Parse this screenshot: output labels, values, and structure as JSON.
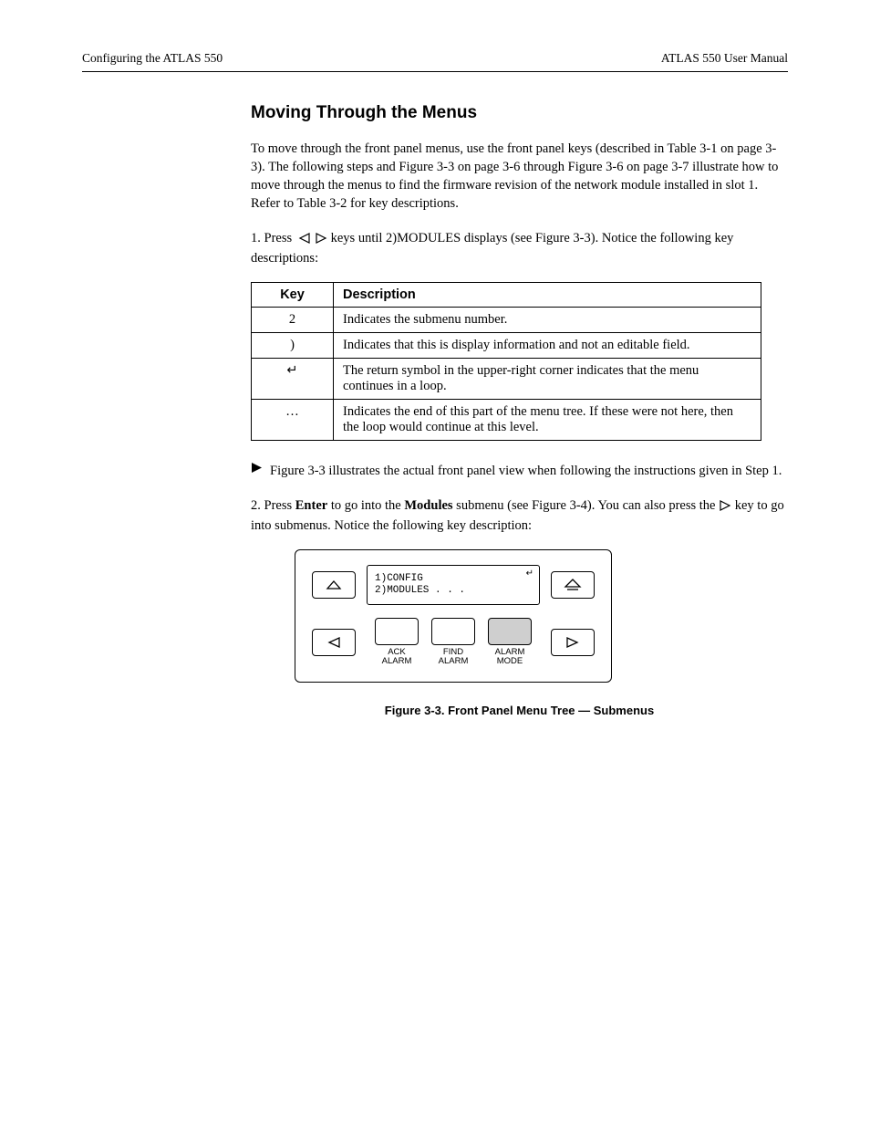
{
  "header": {
    "left": "Configuring the ATLAS 550",
    "right": "ATLAS 550 User Manual"
  },
  "title": "Moving Through the Menus",
  "intro1": "To move through the front panel menus, use the front panel keys (described in Table 3-1 on page 3-3). The following steps and Figure 3-3 on page 3-6 through Figure 3-6 on page 3-7 illustrate how to move through the menus to find the firmware revision of the network module installed in slot 1. Refer to Table 3-2 for key descriptions.",
  "step1_lead": "1.    Press",
  "step1_rest": " keys until 2)MODULES displays (see Figure 3-3). Notice the following key descriptions:",
  "table": {
    "h1": "Key",
    "h2": "Description",
    "rows": [
      {
        "k": "2",
        "d": "Indicates the submenu number."
      },
      {
        "k": ")",
        "d": "Indicates that this is display information and not an editable field."
      },
      {
        "k": "↵",
        "d": "The return symbol in the upper-right corner indicates that the menu continues in a loop."
      },
      {
        "k": "…",
        "d": "Indicates the end of this part of the menu tree. If these were not here, then the loop would continue at this level."
      }
    ]
  },
  "tip": "Figure 3-3 illustrates the actual front panel view when following the instructions given in Step 1.",
  "step2_lead": "2.    Press ",
  "step2_b": "Enter",
  "step2_rest_a": " to go into the ",
  "step2_b2": "Modules",
  "step2_rest_b": " submenu (see Figure 3-4). You can also press the ",
  "step2_rest_c": " key to go into submenus. Notice the following key description:",
  "panel": {
    "lcd_line1": "1)CONFIG",
    "lcd_line2": "2)MODULES   . . .",
    "soft1": "ACK\nALARM",
    "soft2": "FIND\nALARM",
    "soft3": "ALARM\nMODE"
  },
  "figcap": "Figure 3-3. Front Panel Menu Tree — Submenus"
}
